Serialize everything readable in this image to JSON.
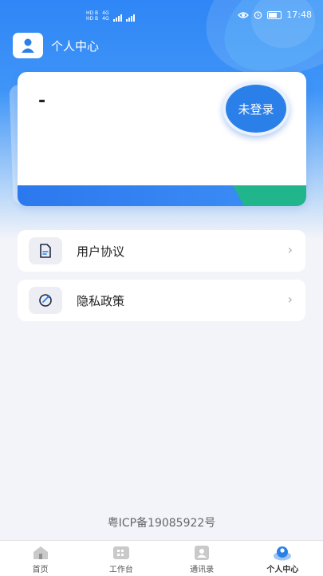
{
  "status_bar": {
    "sim1_label": "HD B",
    "sim1_net": "4G",
    "sim2_label": "HD B",
    "sim2_net": "4G",
    "time": "17:48"
  },
  "header": {
    "title": "个人中心"
  },
  "profile_card": {
    "user_name": "-",
    "login_button": "未登录"
  },
  "menu": {
    "items": [
      {
        "label": "用户协议",
        "icon": "document-icon"
      },
      {
        "label": "隐私政策",
        "icon": "shield-icon"
      }
    ]
  },
  "footer": {
    "icp": "粤ICP备19085922号"
  },
  "tab_bar": {
    "tabs": [
      {
        "label": "首页",
        "icon": "home-icon",
        "active": false
      },
      {
        "label": "工作台",
        "icon": "grid-icon",
        "active": false
      },
      {
        "label": "通讯录",
        "icon": "contacts-icon",
        "active": false
      },
      {
        "label": "个人中心",
        "icon": "profile-icon",
        "active": true
      }
    ]
  },
  "colors": {
    "primary": "#2f86f6",
    "accent_green": "#21b58c",
    "button_blue": "#2a7fe8"
  }
}
